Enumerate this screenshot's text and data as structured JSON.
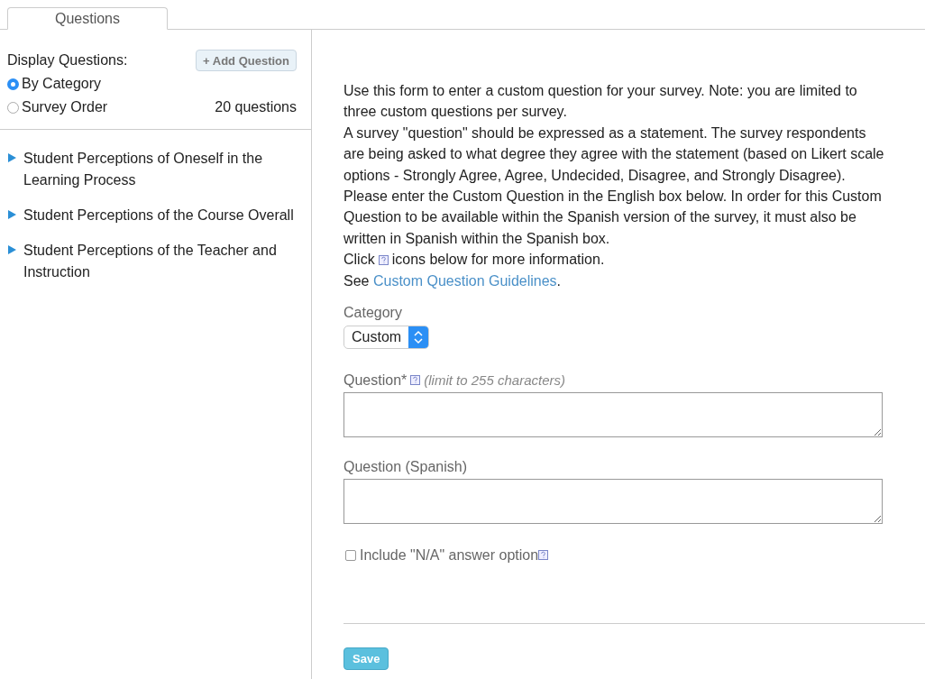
{
  "tabs": [
    {
      "label": "Questions",
      "selected": true
    }
  ],
  "sidebar": {
    "display_label": "Display Questions:",
    "add_button": "+ Add Question",
    "display_options": [
      {
        "label": "By Category",
        "selected": true
      },
      {
        "label": "Survey Order",
        "selected": false
      }
    ],
    "count": "20 questions",
    "categories": [
      {
        "label": "Student Perceptions of Oneself in the Learning Process",
        "expanded": false
      },
      {
        "label": "Student Perceptions of the Course Overall",
        "expanded": false
      },
      {
        "label": "Student Perceptions of the Teacher and Instruction",
        "expanded": false
      }
    ]
  },
  "form": {
    "intro": [
      "Use this form to enter a custom question for your survey. Note: you are limited to three custom questions per survey.",
      "A survey \"question\" should be expressed as a statement. The survey respondents are being asked to what degree they agree with the statement (based on Likert scale options - Strongly Agree, Agree, Undecided, Disagree, and Strongly Disagree).",
      "Please enter the Custom Question in the English box below. In order for this Custom Question to be available within the Spanish version of the survey, it must also be written in Spanish within the Spanish box."
    ],
    "click_line": {
      "before": "Click",
      "after": "icons below for more information."
    },
    "see_line": {
      "before": "See ",
      "link": "Custom Question Guidelines",
      "after": "."
    },
    "category_label": "Category",
    "category_value": "Custom",
    "question_label": "Question*",
    "question_hint": "(limit to 255 characters)",
    "spanish_label": "Question (Spanish)",
    "na_option": {
      "label": "Include \"N/A\" answer option",
      "checked": false
    },
    "save_button": "Save"
  }
}
